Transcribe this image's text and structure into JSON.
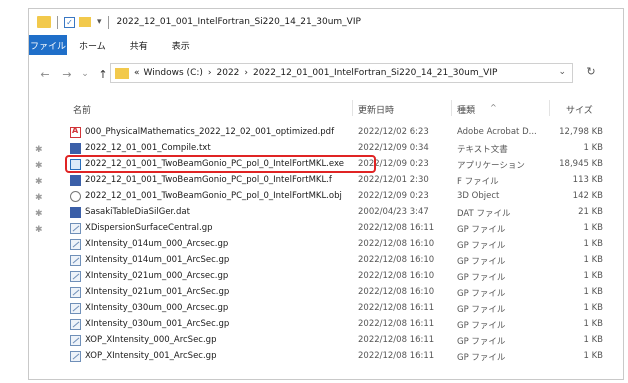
{
  "window": {
    "title": "2022_12_01_001_IntelFortran_Si220_14_21_30um_VIP",
    "quick_access_glyph": "✓",
    "dropdown_glyph": "▾"
  },
  "ribbon": {
    "tabs": [
      "ファイル",
      "ホーム",
      "共有",
      "表示"
    ],
    "active": "ファイル"
  },
  "address_bar": {
    "crumbs": [
      "Windows (C:)",
      "2022",
      "2022_12_01_001_IntelFortran_Si220_14_21_30um_VIP"
    ],
    "prefix": "«",
    "separator": "›",
    "dropdown_glyph": "⌄",
    "refresh_glyph": "↻",
    "nav_glyphs": {
      "back": "←",
      "forward": "→",
      "recent": "⌄",
      "up": "↑"
    }
  },
  "columns": {
    "name": "名前",
    "date": "更新日時",
    "type": "種類",
    "size": "サイズ",
    "sort_glyph": "^"
  },
  "pin_glyph": "✱",
  "files": [
    {
      "name": "000_PhysicalMathematics_2022_12_02_001_optimized.pdf",
      "date": "2022/12/02 6:23",
      "type": "Adobe Acrobat D...",
      "size": "12,798 KB",
      "icon": "pdf-icon",
      "pinned": true
    },
    {
      "name": "2022_12_01_001_Compile.txt",
      "date": "2022/12/09 0:34",
      "type": "テキスト文書",
      "size": "1 KB",
      "icon": "text-file-icon",
      "pinned": true
    },
    {
      "name": "2022_12_01_001_TwoBeamGonio_PC_pol_0_IntelFortMKL.exe",
      "date": "2022/12/09 0:23",
      "type": "アプリケーション",
      "size": "18,945 KB",
      "icon": "exe-icon",
      "pinned": true,
      "highlighted": true
    },
    {
      "name": "2022_12_01_001_TwoBeamGonio_PC_pol_0_IntelFortMKL.f",
      "date": "2022/12/01 2:30",
      "type": "F ファイル",
      "size": "113 KB",
      "icon": "text-file-icon",
      "pinned": true
    },
    {
      "name": "2022_12_01_001_TwoBeamGonio_PC_pol_0_IntelFortMKL.obj",
      "date": "2022/12/09 0:23",
      "type": "3D Object",
      "size": "142 KB",
      "icon": "object-file-icon",
      "pinned": true
    },
    {
      "name": "SasakiTableDiaSilGer.dat",
      "date": "2002/04/23 3:47",
      "type": "DAT ファイル",
      "size": "21 KB",
      "icon": "text-file-icon",
      "pinned": true
    },
    {
      "name": "XDispersionSurfaceCentral.gp",
      "date": "2022/12/08 16:11",
      "type": "GP ファイル",
      "size": "1 KB",
      "icon": "gp-file-icon"
    },
    {
      "name": "XIntensity_014um_000_Arcsec.gp",
      "date": "2022/12/08 16:10",
      "type": "GP ファイル",
      "size": "1 KB",
      "icon": "gp-file-icon"
    },
    {
      "name": "XIntensity_014um_001_ArcSec.gp",
      "date": "2022/12/08 16:10",
      "type": "GP ファイル",
      "size": "1 KB",
      "icon": "gp-file-icon"
    },
    {
      "name": "XIntensity_021um_000_Arcsec.gp",
      "date": "2022/12/08 16:10",
      "type": "GP ファイル",
      "size": "1 KB",
      "icon": "gp-file-icon"
    },
    {
      "name": "XIntensity_021um_001_ArcSec.gp",
      "date": "2022/12/08 16:10",
      "type": "GP ファイル",
      "size": "1 KB",
      "icon": "gp-file-icon"
    },
    {
      "name": "XIntensity_030um_000_Arcsec.gp",
      "date": "2022/12/08 16:11",
      "type": "GP ファイル",
      "size": "1 KB",
      "icon": "gp-file-icon"
    },
    {
      "name": "XIntensity_030um_001_ArcSec.gp",
      "date": "2022/12/08 16:11",
      "type": "GP ファイル",
      "size": "1 KB",
      "icon": "gp-file-icon"
    },
    {
      "name": "XOP_XIntensity_000_ArcSec.gp",
      "date": "2022/12/08 16:11",
      "type": "GP ファイル",
      "size": "1 KB",
      "icon": "gp-file-icon"
    },
    {
      "name": "XOP_XIntensity_001_ArcSec.gp",
      "date": "2022/12/08 16:11",
      "type": "GP ファイル",
      "size": "1 KB",
      "icon": "gp-file-icon"
    }
  ],
  "colors": {
    "accent": "#1f6fc9",
    "highlight_box": "#e02424",
    "folder": "#f2c94c"
  }
}
